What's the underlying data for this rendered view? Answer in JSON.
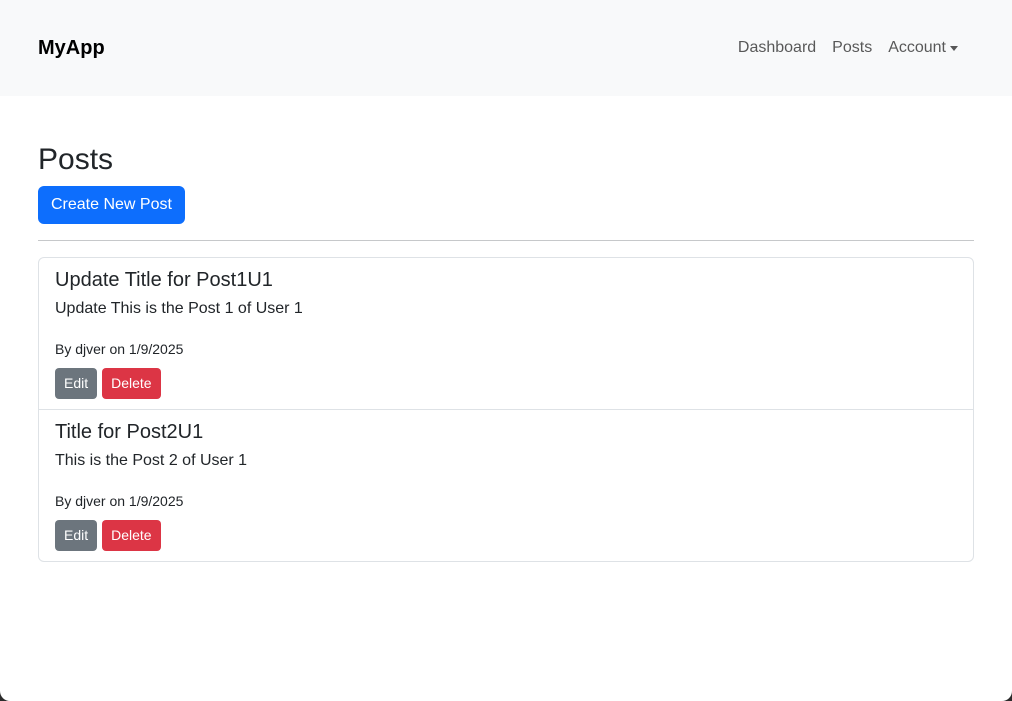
{
  "navbar": {
    "brand": "MyApp",
    "links": [
      "Dashboard",
      "Posts",
      "Account"
    ]
  },
  "page": {
    "title": "Posts",
    "create_button": "Create New Post"
  },
  "posts": [
    {
      "title": "Update Title for Post1U1",
      "body": "Update This is the Post 1 of User 1",
      "meta": "By djver on 1/9/2025",
      "edit_label": "Edit",
      "delete_label": "Delete"
    },
    {
      "title": "Title for Post2U1",
      "body": "This is the Post 2 of User 1",
      "meta": "By djver on 1/9/2025",
      "edit_label": "Edit",
      "delete_label": "Delete"
    }
  ],
  "colors": {
    "primary": "#0d6efd",
    "secondary": "#6c757d",
    "danger": "#dc3545",
    "navbar_bg": "#f8f9fa"
  },
  "icons": {
    "account_dropdown": "caret-down-icon"
  }
}
